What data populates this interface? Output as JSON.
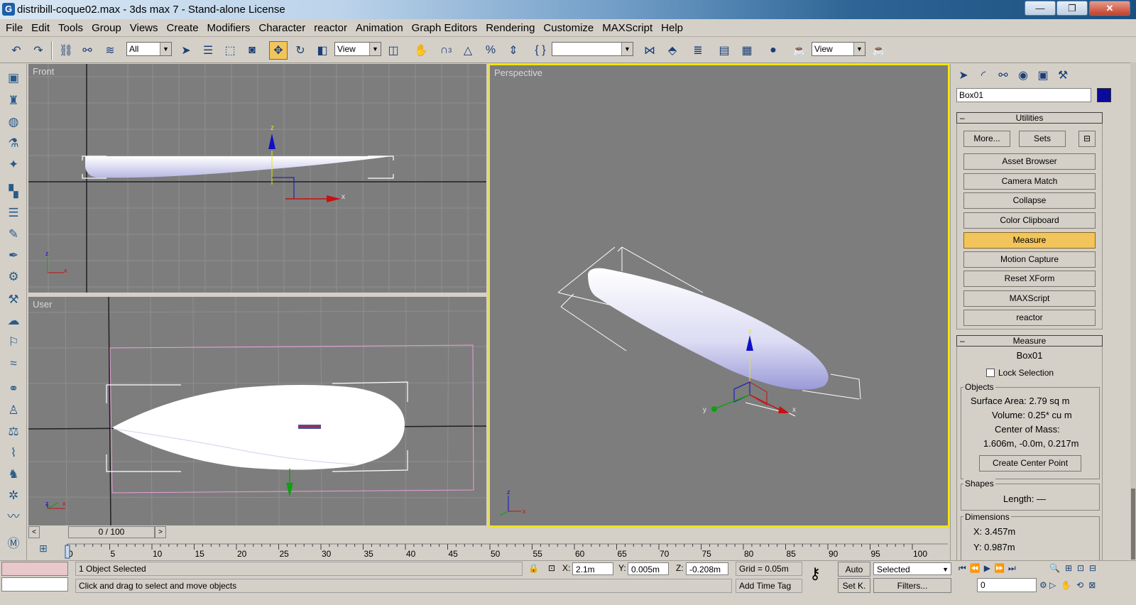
{
  "window": {
    "title": "distribill-coque02.max - 3ds max 7  - Stand-alone License",
    "minimize": "—",
    "maximize": "❐",
    "close": "✕"
  },
  "menu": [
    "File",
    "Edit",
    "Tools",
    "Group",
    "Views",
    "Create",
    "Modifiers",
    "Character",
    "reactor",
    "Animation",
    "Graph Editors",
    "Rendering",
    "Customize",
    "MAXScript",
    "Help"
  ],
  "toolbar": {
    "selection_filter": "All",
    "ref_coord_1": "View",
    "named_selection": "",
    "ref_coord_2": "View",
    "snap_angle_label": "3"
  },
  "viewports": {
    "front": {
      "label": "Front"
    },
    "user": {
      "label": "User"
    },
    "perspective": {
      "label": "Perspective"
    },
    "axis_x": "x",
    "axis_y": "y",
    "axis_z": "z"
  },
  "timeline": {
    "frame_display": "0 / 100",
    "prev": "<",
    "next": ">",
    "ticks": [
      "0",
      "5",
      "10",
      "15",
      "20",
      "25",
      "30",
      "35",
      "40",
      "45",
      "50",
      "55",
      "60",
      "65",
      "70",
      "75",
      "80",
      "85",
      "90",
      "95",
      "100"
    ]
  },
  "status": {
    "selection_info": "1 Object Selected",
    "prompt": "Click and drag to select and move objects",
    "x_label": "X:",
    "x_value": "2.1m",
    "y_label": "Y:",
    "y_value": "0.005m",
    "z_label": "Z:",
    "z_value": "-0.208m",
    "grid": "Grid = 0.05m",
    "auto_key": "Auto",
    "set_key": "Set K.",
    "add_time_tag": "Add Time Tag",
    "key_mode": "Selected",
    "filters": "Filters...",
    "current_frame": "0"
  },
  "command_panel": {
    "object_name": "Box01",
    "object_color": "#0a0a9c",
    "utilities": {
      "header": "Utilities",
      "more": "More...",
      "sets": "Sets",
      "buttons": [
        "Asset Browser",
        "Camera Match",
        "Collapse",
        "Color Clipboard",
        "Measure",
        "Motion Capture",
        "Reset XForm",
        "MAXScript",
        "reactor"
      ],
      "highlighted": "Measure"
    },
    "measure": {
      "header": "Measure",
      "object": "Box01",
      "lock_selection": "Lock Selection",
      "objects_group": "Objects",
      "surface_area": "Surface Area:  2.79 sq m",
      "volume": "Volume:  0.25* cu m",
      "center_of_mass_label": "Center of Mass:",
      "center_of_mass_value": "1.606m, -0.0m, 0.217m",
      "create_center_point": "Create Center Point",
      "shapes_group": "Shapes",
      "length": "Length:  —",
      "dimensions_group": "Dimensions",
      "dim_x": "X:   3.457m",
      "dim_y": "Y:   0.987m"
    }
  },
  "colors": {
    "active_viewport_border": "#f2e60a",
    "viewport_bg": "#7d7d7d",
    "highlight_button": "#f2c55c",
    "selection_bracket_pink": "#e8a0d8"
  }
}
